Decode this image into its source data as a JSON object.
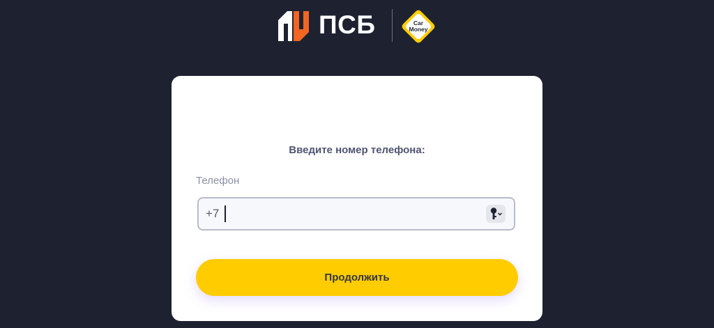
{
  "header": {
    "brand_text": "ПСБ",
    "partner_logo_line1": "Car",
    "partner_logo_line2": "Money"
  },
  "form": {
    "prompt": "Введите номер телефона:",
    "phone_label": "Телефон",
    "phone_prefix": "+7",
    "phone_value": "",
    "submit_label": "Продолжить"
  },
  "icons": {
    "psb_logo": "psb-logo-icon",
    "carmoney_logo": "carmoney-logo-icon",
    "password_manager": "key-icon",
    "dropdown": "chevron-down-icon"
  },
  "colors": {
    "background": "#1e2230",
    "card": "#ffffff",
    "brand_orange": "#f26522",
    "button_yellow": "#ffcc00",
    "carmoney_yellow": "#ffcc00"
  }
}
